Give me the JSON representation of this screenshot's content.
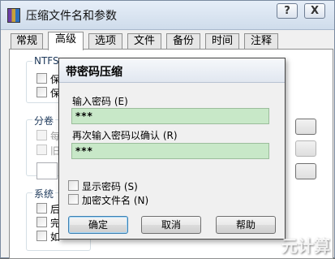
{
  "outer_window": {
    "title": "压缩文件名和参数",
    "help_button": "?",
    "close_button": "X",
    "tabs": [
      "常规",
      "高级",
      "选项",
      "文件",
      "备份",
      "时间",
      "注释"
    ],
    "active_tab": "高级",
    "ntfs_label": "NTFS",
    "ntfs_items": [
      "保",
      "保"
    ],
    "volume_label": "分卷",
    "volume_items": [
      "每",
      "旧"
    ],
    "system_label": "系统",
    "system_items": [
      "后",
      "完",
      "如"
    ]
  },
  "dialog": {
    "title": "带密码压缩",
    "enter_password_label": "输入密码 (E)",
    "password_value": "***",
    "reenter_label": "再次输入密码以确认 (R)",
    "reenter_value": "***",
    "show_password_label": "显示密码 (S)",
    "encrypt_names_label": "加密文件名 (N)",
    "ok_button": "确定",
    "cancel_button": "取消",
    "help_button": "帮助"
  },
  "watermark": "元计算"
}
